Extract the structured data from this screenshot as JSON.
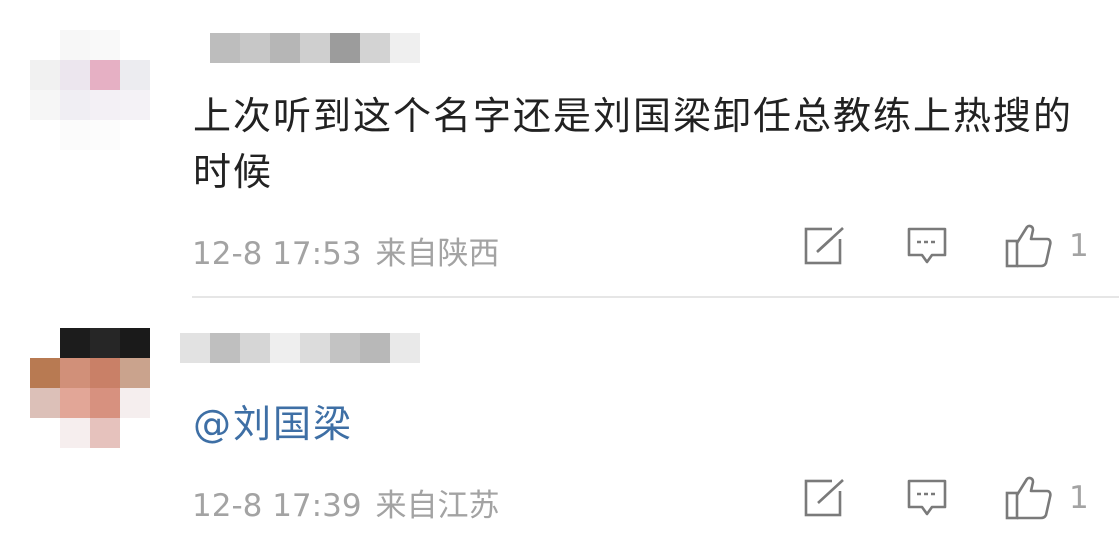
{
  "comments": [
    {
      "username": "",
      "text": "上次听到这个名字还是刘国梁卸任总教练上热搜的时候",
      "mention": "",
      "time": "12-8 17:53",
      "location": "来自陕西",
      "likes": "1",
      "icons": {
        "repost": "repost-icon",
        "reply": "reply-icon",
        "like": "thumbs-up-icon"
      },
      "avatar_colors": [
        "#ffffff",
        "#f7f7f7",
        "#f9f9f9",
        "#ffffff",
        "#f1f1f1",
        "#ece6ee",
        "#e6b0c4",
        "#ececf0",
        "#f6f6f6",
        "#f0eef3",
        "#f3f0f5",
        "#f4f2f6",
        "#ffffff",
        "#fbfbfb",
        "#fcfcfc",
        "#ffffff"
      ],
      "username_colors": [
        "#bdbdbd",
        "#c7c7c7",
        "#b6b6b6",
        "#cfcfcf",
        "#9c9c9c",
        "#d3d3d3",
        "#efefef"
      ]
    },
    {
      "username": "",
      "text": "",
      "mention": "@刘国梁",
      "time": "12-8 17:39",
      "location": "来自江苏",
      "likes": "1",
      "icons": {
        "repost": "repost-icon",
        "reply": "reply-icon",
        "like": "thumbs-up-icon"
      },
      "avatar_colors": [
        "#ffffff",
        "#1c1c1c",
        "#262626",
        "#1a1a1a",
        "#b87a52",
        "#d19079",
        "#c98067",
        "#caa38d",
        "#dcc0b8",
        "#e2a697",
        "#d7917f",
        "#f5eeee",
        "#ffffff",
        "#f6eeee",
        "#e6c2bd",
        "#ffffff"
      ],
      "username_colors": [
        "#e2e2e2",
        "#bfbfbf",
        "#d6d6d6",
        "#eeeeee",
        "#dcdcdc",
        "#c3c3c3",
        "#b8b8b8",
        "#e9e9e9"
      ]
    }
  ]
}
